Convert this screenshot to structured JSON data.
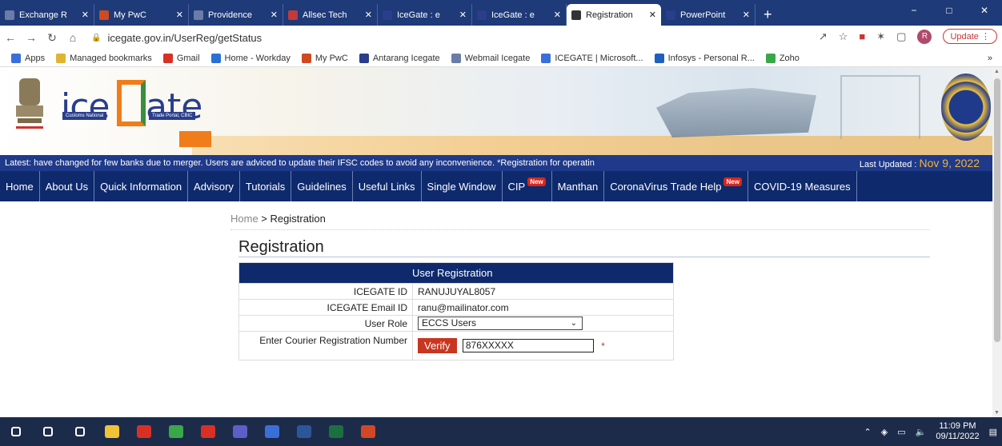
{
  "browser": {
    "tabs": [
      {
        "label": "Exchange R",
        "color": "#6b7ca8",
        "active": false
      },
      {
        "label": "My PwC",
        "color": "#d04a1f",
        "active": false
      },
      {
        "label": "Providence",
        "color": "#6b7ca8",
        "active": false
      },
      {
        "label": "Allsec Tech",
        "color": "#c23a3a",
        "active": false
      },
      {
        "label": "IceGate : e",
        "color": "#2a3e8c",
        "active": false
      },
      {
        "label": "IceGate : e",
        "color": "#2a3e8c",
        "active": false
      },
      {
        "label": "Registration",
        "color": "#333333",
        "active": true
      },
      {
        "label": "PowerPoint",
        "color": "#2a3e8c",
        "active": false
      }
    ],
    "url": "icegate.gov.in/UserReg/getStatus",
    "profile_initial": "R",
    "update_label": "Update",
    "bookmarks": [
      {
        "label": "Apps",
        "color": "#3a6fd8"
      },
      {
        "label": "Managed bookmarks",
        "color": "#e0b430"
      },
      {
        "label": "Gmail",
        "color": "#d93025"
      },
      {
        "label": "Home - Workday",
        "color": "#2a6fd8"
      },
      {
        "label": "My PwC",
        "color": "#d04a1f"
      },
      {
        "label": "Antarang Icegate",
        "color": "#2a3e8c"
      },
      {
        "label": "Webmail Icegate",
        "color": "#6b7ca8"
      },
      {
        "label": "ICEGATE | Microsoft...",
        "color": "#3a6fd8"
      },
      {
        "label": "Infosys - Personal R...",
        "color": "#1f5fbf"
      },
      {
        "label": "Zoho",
        "color": "#3aa84a"
      }
    ]
  },
  "site": {
    "logo_ice": "ice",
    "logo_gate": "ate",
    "logo_sub_left": "Customs National",
    "logo_sub_right": "Trade Portal, CBIC",
    "ticker_text": "Latest:  have changed for few banks due to merger. Users are adviced to update their IFSC codes to avoid any inconvenience. *Registration for operatin",
    "last_updated_label": "Last Updated : ",
    "last_updated_date": "Nov 9, 2022",
    "menu": [
      {
        "label": "Home",
        "new": false
      },
      {
        "label": "About Us",
        "new": false
      },
      {
        "label": "Quick Information",
        "new": false
      },
      {
        "label": "Advisory",
        "new": false
      },
      {
        "label": "Tutorials",
        "new": false
      },
      {
        "label": "Guidelines",
        "new": false
      },
      {
        "label": "Useful Links",
        "new": false
      },
      {
        "label": "Single Window",
        "new": false
      },
      {
        "label": "CIP",
        "new": true
      },
      {
        "label": "Manthan",
        "new": false
      },
      {
        "label": "CoronaVirus Trade Help",
        "new": true
      },
      {
        "label": "COVID-19 Measures",
        "new": false
      }
    ],
    "new_badge": "New"
  },
  "page": {
    "breadcrumb_home": "Home",
    "breadcrumb_sep": " > ",
    "breadcrumb_current": "Registration",
    "title": "Registration",
    "form_header": "User Registration",
    "icegate_id_label": "ICEGATE ID",
    "icegate_id_value": "RANUJUYAL8057",
    "email_label": "ICEGATE Email ID",
    "email_value": "ranu@mailinator.com",
    "role_label": "User Role",
    "role_value": "ECCS Users",
    "courier_label": "Enter Courier Registration Number",
    "verify_label": "Verify",
    "courier_value": "876XXXXX",
    "required_mark": "*"
  },
  "taskbar": {
    "apps": [
      "#ffffff",
      "#ffffff",
      "#ffffff",
      "#f0c23a",
      "#d93025",
      "#3aa84a",
      "#d93025",
      "#5b5fc7",
      "#3a6fd8",
      "#2b579a",
      "#1d6f42",
      "#d24726"
    ],
    "time": "11:09 PM",
    "date": "09/11/2022"
  }
}
